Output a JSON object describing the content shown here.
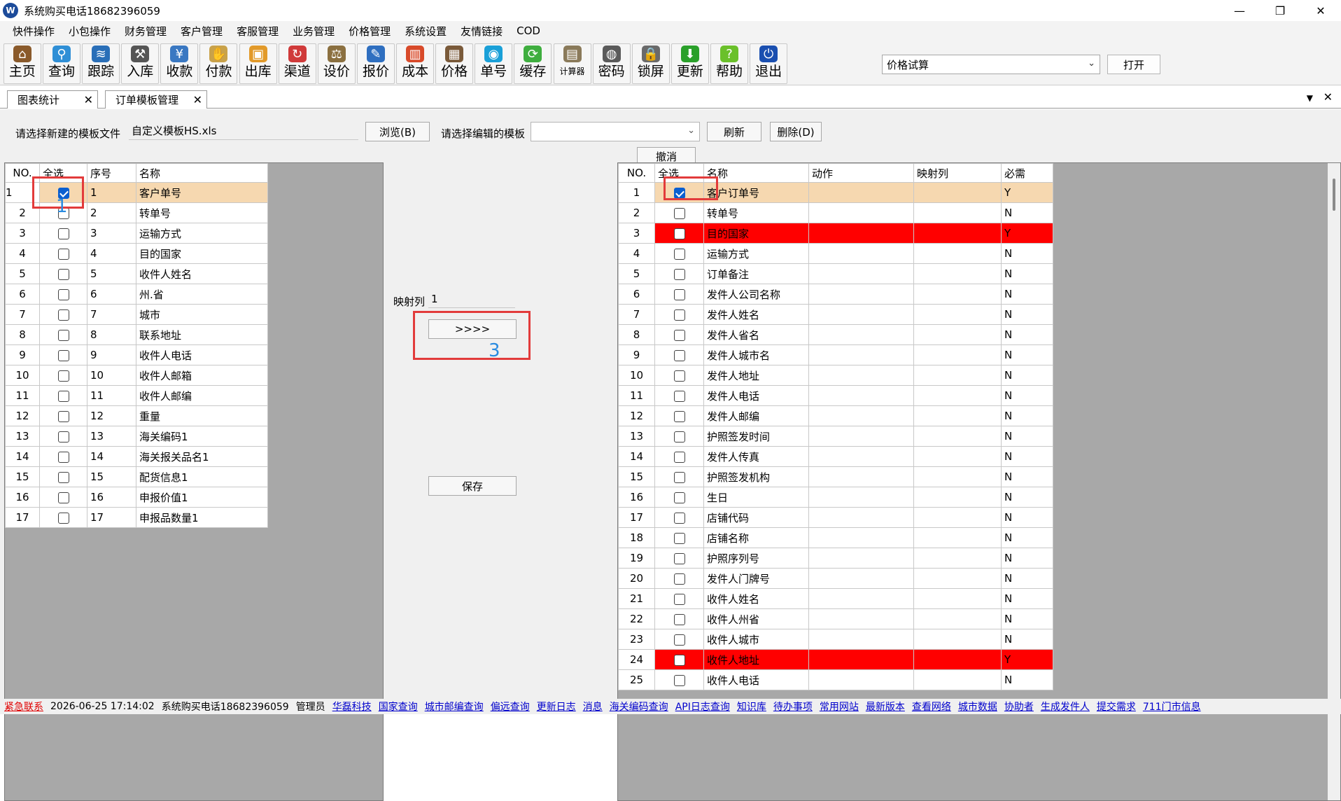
{
  "window": {
    "title": "系统购买电话18682396059",
    "logo": "W",
    "minimize": "—",
    "maximize": "❐",
    "close": "✕"
  },
  "menu": [
    "快件操作",
    "小包操作",
    "财务管理",
    "客户管理",
    "客服管理",
    "业务管理",
    "价格管理",
    "系统设置",
    "友情链接",
    "COD"
  ],
  "toolbar": {
    "buttons": [
      {
        "label": "主页",
        "icon": "home-icon",
        "color": "#8a5a2b",
        "glyph": "⌂"
      },
      {
        "label": "查询",
        "icon": "magnifier-icon",
        "color": "#2f8fd6",
        "glyph": "⚲"
      },
      {
        "label": "跟踪",
        "icon": "wifi-icon",
        "color": "#2a6fb8",
        "glyph": "≋"
      },
      {
        "label": "入库",
        "icon": "hammer-icon",
        "color": "#555555",
        "glyph": "⚒"
      },
      {
        "label": "收款",
        "icon": "yen-icon",
        "color": "#3a78c2",
        "glyph": "¥"
      },
      {
        "label": "付款",
        "icon": "hand-money-icon",
        "color": "#c9a24a",
        "glyph": "✋"
      },
      {
        "label": "出库",
        "icon": "box-icon",
        "color": "#e29a2a",
        "glyph": "▣"
      },
      {
        "label": "渠道",
        "icon": "cycle-icon",
        "color": "#d03a3a",
        "glyph": "↻"
      },
      {
        "label": "设价",
        "icon": "scale-icon",
        "color": "#8b7040",
        "glyph": "⚖"
      },
      {
        "label": "报价",
        "icon": "folder-pen-icon",
        "color": "#2f6fc0",
        "glyph": "✎"
      },
      {
        "label": "成本",
        "icon": "bar-chart-icon",
        "color": "#d84a2a",
        "glyph": "▥"
      },
      {
        "label": "价格",
        "icon": "calendar-icon",
        "color": "#7a5a3a",
        "glyph": "▦"
      },
      {
        "label": "单号",
        "icon": "eye-icon",
        "color": "#1aa0d8",
        "glyph": "◉"
      },
      {
        "label": "缓存",
        "icon": "refresh-icon",
        "color": "#3fae3f",
        "glyph": "⟳"
      },
      {
        "label": "计算器",
        "icon": "calculator-icon",
        "color": "#8a7a5a",
        "glyph": "▤"
      },
      {
        "label": "密码",
        "icon": "safe-icon",
        "color": "#5a5a5a",
        "glyph": "◍"
      },
      {
        "label": "锁屏",
        "icon": "lock-icon",
        "color": "#6a6a6a",
        "glyph": "🔒"
      },
      {
        "label": "更新",
        "icon": "download-arrow-icon",
        "color": "#2aa02a",
        "glyph": "⬇"
      },
      {
        "label": "帮助",
        "icon": "help-icon",
        "color": "#6ac02a",
        "glyph": "?"
      },
      {
        "label": "退出",
        "icon": "power-icon",
        "color": "#1a4fb0",
        "glyph": "⏻"
      }
    ],
    "calc_select": "价格试算",
    "open_button": "打开"
  },
  "tabs": [
    {
      "label": "图表统计",
      "close": "✕"
    },
    {
      "label": "订单模板管理",
      "close": "✕"
    }
  ],
  "tab_menu_arrow": "▼",
  "tab_close_all": "✕",
  "form": {
    "new_template_label": "请选择新建的模板文件",
    "new_template_value": "自定义模板HS.xls",
    "browse_button": "浏览(B)",
    "edit_template_label": "请选择编辑的模板",
    "edit_template_value": "",
    "refresh_button": "刷新",
    "delete_button": "删除(D)",
    "undo_button": "撤消",
    "mapping_label": "映射列",
    "mapping_value": "1",
    "transfer_button": ">>>>",
    "save_button": "保存"
  },
  "left_grid": {
    "headers": {
      "no": "NO.",
      "select_all": "全选",
      "seq": "序号",
      "name": "名称"
    },
    "rows": [
      {
        "no": "1",
        "checked": true,
        "seq": "1",
        "name": "客户单号"
      },
      {
        "no": "2",
        "checked": false,
        "seq": "2",
        "name": "转单号"
      },
      {
        "no": "3",
        "checked": false,
        "seq": "3",
        "name": "运输方式"
      },
      {
        "no": "4",
        "checked": false,
        "seq": "4",
        "name": "目的国家"
      },
      {
        "no": "5",
        "checked": false,
        "seq": "5",
        "name": "收件人姓名"
      },
      {
        "no": "6",
        "checked": false,
        "seq": "6",
        "name": "州.省"
      },
      {
        "no": "7",
        "checked": false,
        "seq": "7",
        "name": "城市"
      },
      {
        "no": "8",
        "checked": false,
        "seq": "8",
        "name": "联系地址"
      },
      {
        "no": "9",
        "checked": false,
        "seq": "9",
        "name": "收件人电话"
      },
      {
        "no": "10",
        "checked": false,
        "seq": "10",
        "name": "收件人邮箱"
      },
      {
        "no": "11",
        "checked": false,
        "seq": "11",
        "name": "收件人邮编"
      },
      {
        "no": "12",
        "checked": false,
        "seq": "12",
        "name": "重量"
      },
      {
        "no": "13",
        "checked": false,
        "seq": "13",
        "name": "海关编码1"
      },
      {
        "no": "14",
        "checked": false,
        "seq": "14",
        "name": "海关报关品名1"
      },
      {
        "no": "15",
        "checked": false,
        "seq": "15",
        "name": "配货信息1"
      },
      {
        "no": "16",
        "checked": false,
        "seq": "16",
        "name": "申报价值1"
      },
      {
        "no": "17",
        "checked": false,
        "seq": "17",
        "name": "申报品数量1"
      }
    ]
  },
  "right_grid": {
    "headers": {
      "no": "NO.",
      "select_all": "全选",
      "name": "名称",
      "action": "动作",
      "mapping": "映射列",
      "required": "必需"
    },
    "rows": [
      {
        "no": "1",
        "checked": true,
        "name": "客户订单号",
        "action": "",
        "mapping": "",
        "required": "Y",
        "state": "selected"
      },
      {
        "no": "2",
        "checked": false,
        "name": "转单号",
        "action": "",
        "mapping": "",
        "required": "N",
        "state": ""
      },
      {
        "no": "3",
        "checked": false,
        "name": "目的国家",
        "action": "",
        "mapping": "",
        "required": "Y",
        "state": "red"
      },
      {
        "no": "4",
        "checked": false,
        "name": "运输方式",
        "action": "",
        "mapping": "",
        "required": "N",
        "state": ""
      },
      {
        "no": "5",
        "checked": false,
        "name": "订单备注",
        "action": "",
        "mapping": "",
        "required": "N",
        "state": ""
      },
      {
        "no": "6",
        "checked": false,
        "name": "发件人公司名称",
        "action": "",
        "mapping": "",
        "required": "N",
        "state": ""
      },
      {
        "no": "7",
        "checked": false,
        "name": "发件人姓名",
        "action": "",
        "mapping": "",
        "required": "N",
        "state": ""
      },
      {
        "no": "8",
        "checked": false,
        "name": "发件人省名",
        "action": "",
        "mapping": "",
        "required": "N",
        "state": ""
      },
      {
        "no": "9",
        "checked": false,
        "name": "发件人城市名",
        "action": "",
        "mapping": "",
        "required": "N",
        "state": ""
      },
      {
        "no": "10",
        "checked": false,
        "name": "发件人地址",
        "action": "",
        "mapping": "",
        "required": "N",
        "state": ""
      },
      {
        "no": "11",
        "checked": false,
        "name": "发件人电话",
        "action": "",
        "mapping": "",
        "required": "N",
        "state": ""
      },
      {
        "no": "12",
        "checked": false,
        "name": "发件人邮编",
        "action": "",
        "mapping": "",
        "required": "N",
        "state": ""
      },
      {
        "no": "13",
        "checked": false,
        "name": "护照签发时间",
        "action": "",
        "mapping": "",
        "required": "N",
        "state": ""
      },
      {
        "no": "14",
        "checked": false,
        "name": "发件人传真",
        "action": "",
        "mapping": "",
        "required": "N",
        "state": ""
      },
      {
        "no": "15",
        "checked": false,
        "name": "护照签发机构",
        "action": "",
        "mapping": "",
        "required": "N",
        "state": ""
      },
      {
        "no": "16",
        "checked": false,
        "name": "生日",
        "action": "",
        "mapping": "",
        "required": "N",
        "state": ""
      },
      {
        "no": "17",
        "checked": false,
        "name": "店铺代码",
        "action": "",
        "mapping": "",
        "required": "N",
        "state": ""
      },
      {
        "no": "18",
        "checked": false,
        "name": "店铺名称",
        "action": "",
        "mapping": "",
        "required": "N",
        "state": ""
      },
      {
        "no": "19",
        "checked": false,
        "name": "护照序列号",
        "action": "",
        "mapping": "",
        "required": "N",
        "state": ""
      },
      {
        "no": "20",
        "checked": false,
        "name": "发件人门牌号",
        "action": "",
        "mapping": "",
        "required": "N",
        "state": ""
      },
      {
        "no": "21",
        "checked": false,
        "name": "收件人姓名",
        "action": "",
        "mapping": "",
        "required": "N",
        "state": ""
      },
      {
        "no": "22",
        "checked": false,
        "name": "收件人州省",
        "action": "",
        "mapping": "",
        "required": "N",
        "state": ""
      },
      {
        "no": "23",
        "checked": false,
        "name": "收件人城市",
        "action": "",
        "mapping": "",
        "required": "N",
        "state": ""
      },
      {
        "no": "24",
        "checked": false,
        "name": "收件人地址",
        "action": "",
        "mapping": "",
        "required": "Y",
        "state": "red"
      },
      {
        "no": "25",
        "checked": false,
        "name": "收件人电话",
        "action": "",
        "mapping": "",
        "required": "N",
        "state": ""
      }
    ]
  },
  "annotations": {
    "one": "1",
    "three": "3"
  },
  "status": {
    "urgent": "紧急联系",
    "datetime": "2026-06-25 17:14:02",
    "phone": "系统购买电话18682396059",
    "user": "管理员",
    "links": [
      "华磊科技",
      "国家查询",
      "城市邮编查询",
      "偏远查询",
      "更新日志",
      "消息",
      "海关编码查询",
      "API日志查询",
      "知识库",
      "待办事项",
      "常用网站",
      "最新版本",
      "查看网络",
      "城市数据",
      "协助者",
      "生成发件人",
      "提交需求",
      "711门市信息"
    ]
  }
}
